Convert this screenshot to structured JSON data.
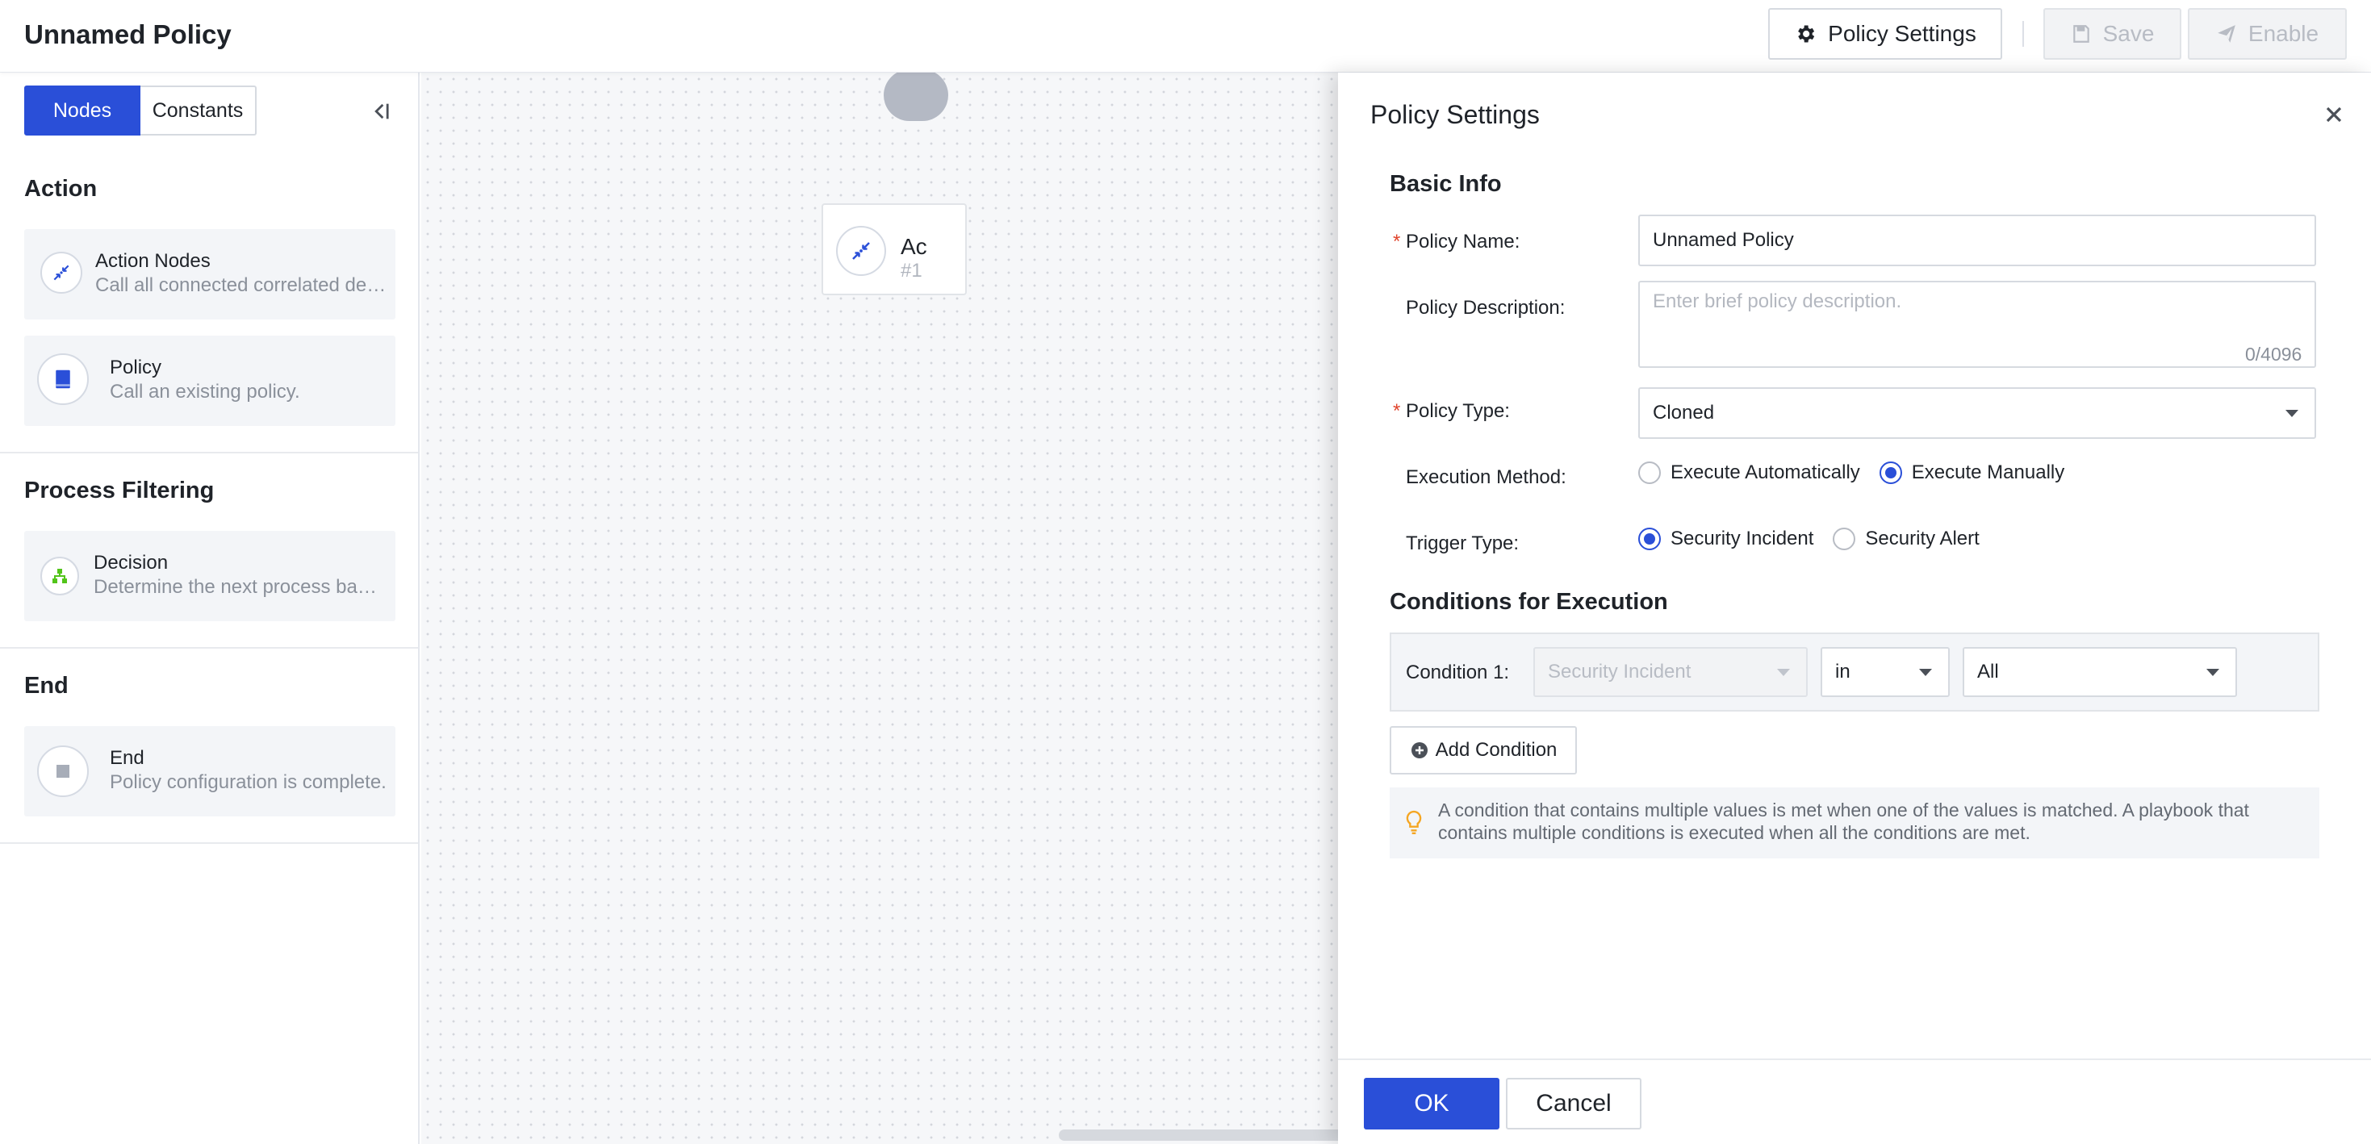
{
  "header": {
    "title": "Unnamed Policy",
    "policy_settings_label": "Policy Settings",
    "save_label": "Save",
    "enable_label": "Enable"
  },
  "sidebar": {
    "tabs": [
      {
        "label": "Nodes",
        "active": true
      },
      {
        "label": "Constants",
        "active": false
      }
    ],
    "sections": [
      {
        "title": "Action",
        "nodes": [
          {
            "name": "Action Nodes",
            "desc": "Call all connected correlated devices.",
            "icon": "action-arrows-icon"
          },
          {
            "name": "Policy",
            "desc": "Call an existing policy.",
            "icon": "book-icon"
          }
        ]
      },
      {
        "title": "Process Filtering",
        "nodes": [
          {
            "name": "Decision",
            "desc": "Determine the next process based on conditions.",
            "icon": "decision-tree-icon"
          }
        ]
      },
      {
        "title": "End",
        "nodes": [
          {
            "name": "End",
            "desc": "Policy configuration is complete.",
            "icon": "stop-square-icon"
          }
        ]
      }
    ]
  },
  "canvas": {
    "node_label": "Ac",
    "node_id": "#1"
  },
  "drawer": {
    "title": "Policy Settings",
    "basic_info_title": "Basic Info",
    "policy_name_label": "Policy Name:",
    "policy_name_value": "Unnamed Policy",
    "policy_desc_label": "Policy Description:",
    "policy_desc_placeholder": "Enter brief policy description.",
    "policy_desc_count": "0/4096",
    "policy_type_label": "Policy Type:",
    "policy_type_value": "Cloned",
    "exec_method_label": "Execution Method:",
    "exec_method_options": [
      {
        "label": "Execute Automatically",
        "checked": false
      },
      {
        "label": "Execute Manually",
        "checked": true
      }
    ],
    "trigger_type_label": "Trigger Type:",
    "trigger_type_options": [
      {
        "label": "Security Incident",
        "checked": true
      },
      {
        "label": "Security Alert",
        "checked": false
      }
    ],
    "conditions_title": "Conditions for Execution",
    "condition": {
      "label": "Condition 1:",
      "field": "Security Incident",
      "operator": "in",
      "value": "All"
    },
    "add_condition_label": "Add Condition",
    "tip": "A condition that contains multiple values is met when one of the values is matched. A playbook that contains multiple conditions is executed when all the conditions are met.",
    "ok_label": "OK",
    "cancel_label": "Cancel"
  },
  "colors": {
    "primary": "#2a4fd8",
    "required": "#e0442c",
    "tip_icon": "#f5a623",
    "decision_icon": "#52c41a"
  }
}
